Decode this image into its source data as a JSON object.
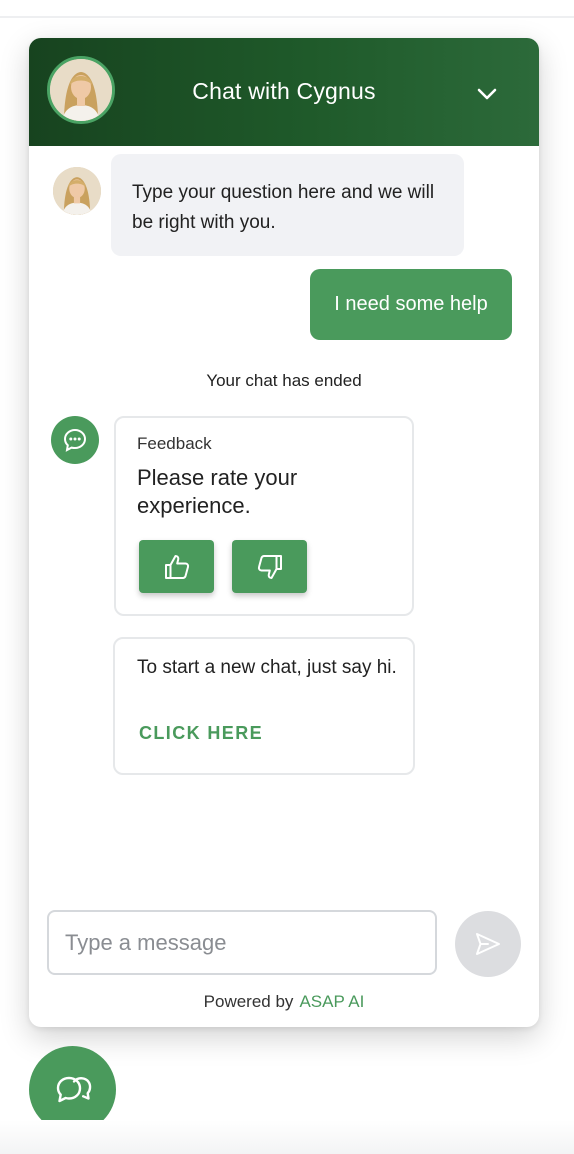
{
  "header": {
    "title": "Chat with Cygnus",
    "icons": {
      "avatar": "agent-avatar",
      "collapse": "chevron-down-icon"
    }
  },
  "messages": {
    "bot_greeting": "Type your question here and we will be right with you.",
    "user_message": "I need some help",
    "status": "Your chat has ended"
  },
  "feedback": {
    "label": "Feedback",
    "prompt": "Please rate your experience.",
    "icons": {
      "badge": "chat-bubble-icon",
      "up": "thumbs-up-icon",
      "down": "thumbs-down-icon"
    }
  },
  "new_chat": {
    "text": "To start a new chat, just say hi.",
    "link": "CLICK HERE"
  },
  "composer": {
    "placeholder": "Type a message",
    "send_icon": "send-icon"
  },
  "footer": {
    "powered_by": "Powered by",
    "brand": "ASAP AI"
  },
  "launcher": {
    "icon": "chat-bubbles-icon"
  },
  "colors": {
    "accent": "#4a9a5c",
    "header_dark": "#17431f",
    "bubble_bg": "#f1f2f5"
  }
}
